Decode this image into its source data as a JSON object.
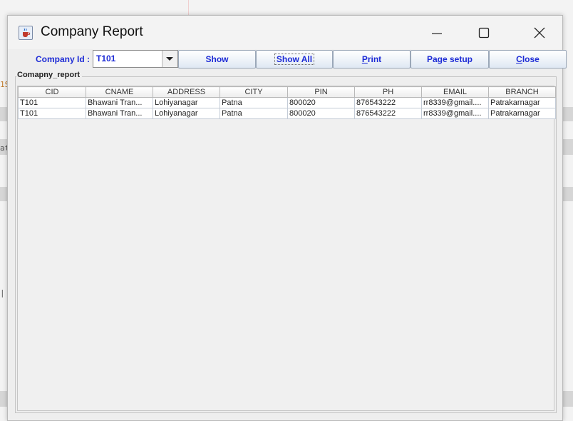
{
  "window": {
    "title": "Company Report"
  },
  "toolbar": {
    "company_label": "Company Id :",
    "company_value": "T101",
    "show": "Show",
    "show_all": "Show All",
    "print_p": "P",
    "print_rest": "rint",
    "page_setup": "Page setup",
    "close_c": "C",
    "close_rest": "lose"
  },
  "panel": {
    "title": "Comapny_report"
  },
  "table": {
    "headers": [
      "CID",
      "CNAME",
      "ADDRESS",
      "CITY",
      "PIN",
      "PH",
      "EMAIL",
      "BRANCH"
    ],
    "rows": [
      [
        "T101",
        "Bhawani Tran...",
        "Lohiyanagar",
        "Patna",
        "800020",
        "876543222",
        "rr8339@gmail....",
        "Patrakarnagar"
      ],
      [
        "T101",
        "Bhawani Tran...",
        "Lohiyanagar",
        "Patna",
        "800020",
        "876543222",
        "rr8339@gmail....",
        "Patrakarnagar"
      ]
    ]
  },
  "background": {
    "fragments": [
      "1S",
      "at",
      "|"
    ]
  },
  "colors": {
    "accent_text": "#1d2bd6",
    "button_bg": "#dfe8f3"
  },
  "icons": {
    "app": "java-cup-icon",
    "minimize": "minimize-icon",
    "maximize": "maximize-icon",
    "close": "close-icon",
    "dropdown": "chevron-down-icon"
  }
}
